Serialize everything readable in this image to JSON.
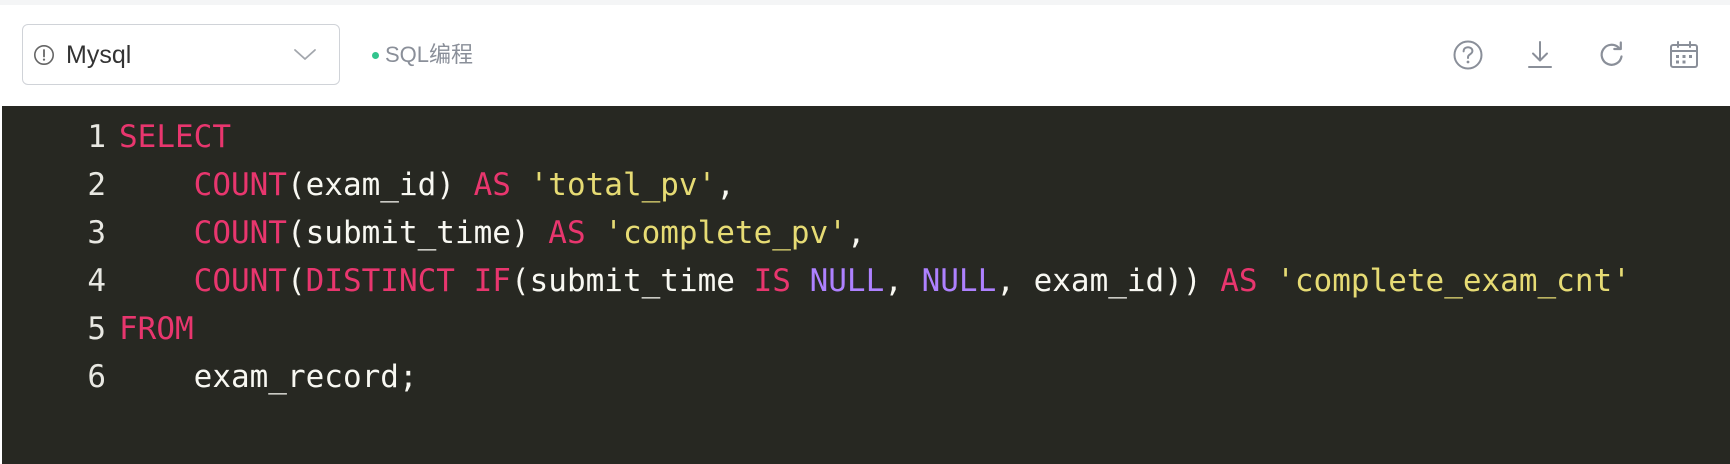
{
  "toolbar": {
    "language_select": {
      "value": "Mysql",
      "icon": "info-circle-icon"
    },
    "mode_tag": {
      "label": "SQL编程",
      "dot_color": "#32c48d"
    },
    "actions": [
      {
        "name": "help",
        "icon": "help-circle-icon"
      },
      {
        "name": "download",
        "icon": "download-icon"
      },
      {
        "name": "refresh",
        "icon": "refresh-icon"
      },
      {
        "name": "calendar",
        "icon": "calendar-icon"
      }
    ]
  },
  "editor": {
    "background": "#272822",
    "colors": {
      "keyword": "#e8366e",
      "null": "#ae81ff",
      "string": "#e6db74",
      "plain": "#f8f8f2"
    },
    "lines": [
      {
        "number": "1",
        "tokens": [
          {
            "t": "SELECT",
            "k": "kw"
          }
        ]
      },
      {
        "number": "2",
        "tokens": [
          {
            "t": "    ",
            "k": "pl"
          },
          {
            "t": "COUNT",
            "k": "fn"
          },
          {
            "t": "(exam_id) ",
            "k": "pl"
          },
          {
            "t": "AS",
            "k": "kw"
          },
          {
            "t": " ",
            "k": "pl"
          },
          {
            "t": "'total_pv'",
            "k": "str"
          },
          {
            "t": ",",
            "k": "pl"
          }
        ]
      },
      {
        "number": "3",
        "tokens": [
          {
            "t": "    ",
            "k": "pl"
          },
          {
            "t": "COUNT",
            "k": "fn"
          },
          {
            "t": "(submit_time) ",
            "k": "pl"
          },
          {
            "t": "AS",
            "k": "kw"
          },
          {
            "t": " ",
            "k": "pl"
          },
          {
            "t": "'complete_pv'",
            "k": "str"
          },
          {
            "t": ",",
            "k": "pl"
          }
        ]
      },
      {
        "number": "4",
        "tokens": [
          {
            "t": "    ",
            "k": "pl"
          },
          {
            "t": "COUNT",
            "k": "fn"
          },
          {
            "t": "(",
            "k": "pl"
          },
          {
            "t": "DISTINCT",
            "k": "kw"
          },
          {
            "t": " ",
            "k": "pl"
          },
          {
            "t": "IF",
            "k": "kw"
          },
          {
            "t": "(submit_time ",
            "k": "pl"
          },
          {
            "t": "IS",
            "k": "kw"
          },
          {
            "t": " ",
            "k": "pl"
          },
          {
            "t": "NULL",
            "k": "nul"
          },
          {
            "t": ", ",
            "k": "pl"
          },
          {
            "t": "NULL",
            "k": "nul"
          },
          {
            "t": ", exam_id)) ",
            "k": "pl"
          },
          {
            "t": "AS",
            "k": "kw"
          },
          {
            "t": " ",
            "k": "pl"
          },
          {
            "t": "'complete_exam_cnt'",
            "k": "str"
          }
        ]
      },
      {
        "number": "5",
        "tokens": [
          {
            "t": "FROM",
            "k": "kw"
          }
        ]
      },
      {
        "number": "6",
        "tokens": [
          {
            "t": "    ",
            "k": "pl"
          },
          {
            "t": "exam_record;",
            "k": "pl"
          }
        ]
      }
    ]
  }
}
